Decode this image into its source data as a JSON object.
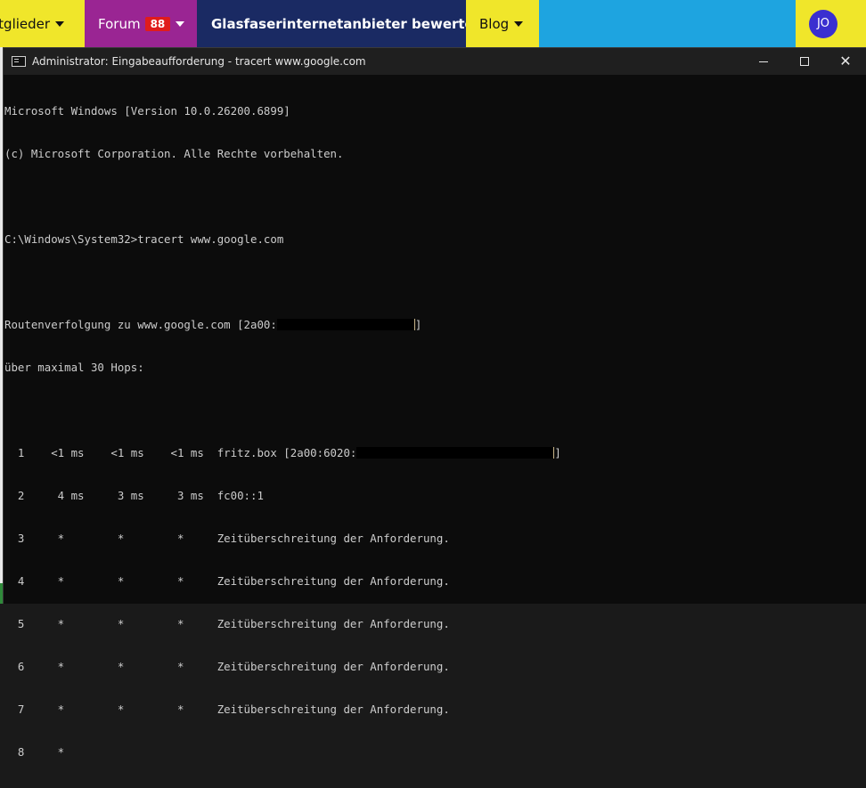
{
  "nav": {
    "mitglieder": "itglieder",
    "forum": "Forum",
    "forum_badge": "88",
    "rate": "Glasfaserinternetanbieter bewerten",
    "blog": "Blog",
    "user_initials": "JO"
  },
  "window": {
    "title": "Administrator: Eingabeaufforderung - tracert  www.google.com",
    "minimize": "—",
    "maximize": "☐",
    "close": "✕"
  },
  "console": {
    "header1": "Microsoft Windows [Version 10.0.26200.6899]",
    "header2": "(c) Microsoft Corporation. Alle Rechte vorbehalten.",
    "prompt": "C:\\Windows\\System32>tracert www.google.com",
    "route_prefix": "Routenverfolgung zu www.google.com [2a00:",
    "route_suffix": "]",
    "max_hops": "über maximal 30 Hops:",
    "hop1_prefix": "  1    <1 ms    <1 ms    <1 ms  fritz.box [2a00:6020:",
    "hop1_suffix": "]",
    "hop2": "  2     4 ms     3 ms     3 ms  fc00::1",
    "hop3": "  3     *        *        *     Zeitüberschreitung der Anforderung.",
    "hop4": "  4     *        *        *     Zeitüberschreitung der Anforderung.",
    "hop5": "  5     *        *        *     Zeitüberschreitung der Anforderung.",
    "hop6": "  6     *        *        *     Zeitüberschreitung der Anforderung.",
    "hop7": "  7     *        *        *     Zeitüberschreitung der Anforderung.",
    "hop8": "  8     *"
  },
  "colors": {
    "console_bg": "#0c0c0c",
    "console_text": "#cccccc",
    "titlebar_bg": "#1f1f1f",
    "nav_yellow": "#f0e62a",
    "nav_purple": "#9a2593",
    "nav_navy": "#1a2a63",
    "nav_blue": "#1ea4e0",
    "badge_red": "#e01c1c",
    "avatar": "#3a2fd0"
  }
}
